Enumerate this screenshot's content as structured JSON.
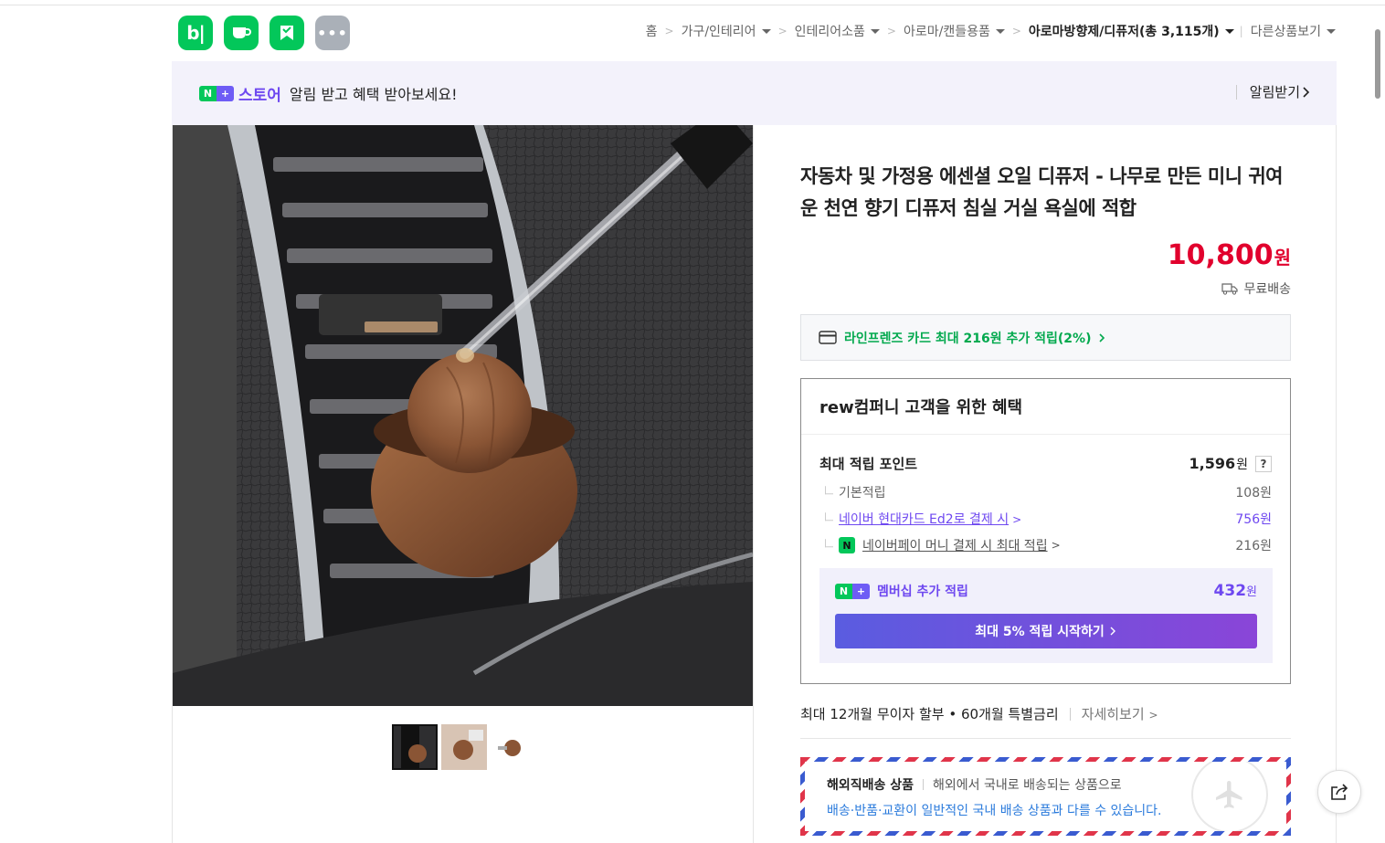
{
  "services": [
    {
      "name": "blog",
      "glyph": "b|"
    },
    {
      "name": "cafe",
      "glyph": ""
    },
    {
      "name": "pay",
      "glyph": ""
    },
    {
      "name": "more",
      "glyph": "•••"
    }
  ],
  "breadcrumb": {
    "home": "홈",
    "items": [
      "가구/인테리어",
      "인테리어소품",
      "아로마/캔들용품"
    ],
    "current": "아로마방향제/디퓨저(총 3,115개)",
    "other": "다른상품보기"
  },
  "banner": {
    "n_glyph": "N",
    "plus_glyph": "+",
    "store": "스토어",
    "message": "알림 받고 혜택 받아보세요!",
    "action": "알림받기"
  },
  "product": {
    "title": "자동차 및 가정용 에센셜 오일 디퓨저 - 나무로 만든 미니 귀여운 천연 향기 디퓨저 침실 거실 욕실에 적합",
    "price": "10,800",
    "price_unit": "원",
    "shipping": "무료배송"
  },
  "card_promo": "라인프렌즈 카드 최대 216원 추가 적립(2%)",
  "benefit": {
    "heading": "rew컴퍼니 고객을 위한 혜택",
    "max_label": "최대 적립 포인트",
    "max_value": "1,596",
    "won": "원",
    "help": "?",
    "base_label": "기본적립",
    "base_value": "108원",
    "hyundai_label": "네이버 현대카드 Ed2로 결제 시",
    "hyundai_value": "756원",
    "npay_icon": "N",
    "npay_label": "네이버페이 머니 결제 시 최대 적립",
    "npay_value": "216원",
    "member_label": "멤버십 추가 적립",
    "member_value": "432",
    "member_button": "최대 5% 적립 시작하기"
  },
  "installment": {
    "text": "최대 12개월 무이자 할부 • 60개월 특별금리",
    "more": "자세히보기"
  },
  "overseas": {
    "title": "해외직배송 상품",
    "desc": "해외에서 국내로 배송되는 상품으로",
    "note": "배송·반품·교환이 일반적인 국내 배송 상품과 다를 수 있습니다."
  },
  "colors": {
    "naver_green": "#03c75a",
    "price_red": "#e1002d",
    "membership_purple": "#6e48f0",
    "banner_bg": "#f3f2fb"
  },
  "icons": [
    "blog-icon",
    "cafe-icon",
    "pay-icon",
    "more-icon",
    "truck-icon",
    "card-icon",
    "share-icon",
    "airplane-icon"
  ]
}
